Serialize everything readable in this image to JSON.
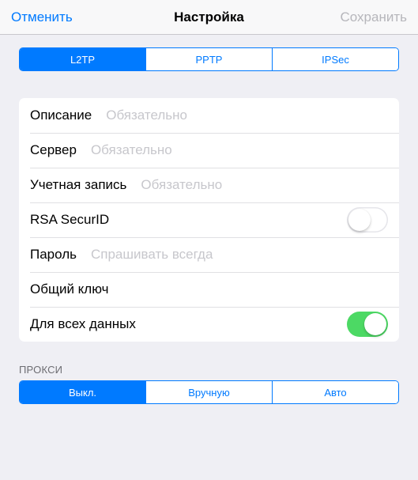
{
  "nav": {
    "cancel": "Отменить",
    "title": "Настройка",
    "save": "Сохранить"
  },
  "vpnType": {
    "options": [
      "L2TP",
      "PPTP",
      "IPSec"
    ],
    "selected": 0
  },
  "fields": {
    "description": {
      "label": "Описание",
      "placeholder": "Обязательно",
      "value": ""
    },
    "server": {
      "label": "Сервер",
      "placeholder": "Обязательно",
      "value": ""
    },
    "account": {
      "label": "Учетная запись",
      "placeholder": "Обязательно",
      "value": ""
    },
    "rsa": {
      "label": "RSA SecurID",
      "on": false
    },
    "password": {
      "label": "Пароль",
      "placeholder": "Спрашивать всегда",
      "value": ""
    },
    "secret": {
      "label": "Общий ключ",
      "value": ""
    },
    "sendAll": {
      "label": "Для всех данных",
      "on": true
    }
  },
  "proxy": {
    "header": "ПРОКСИ",
    "options": [
      "Выкл.",
      "Вручную",
      "Авто"
    ],
    "selected": 0
  }
}
